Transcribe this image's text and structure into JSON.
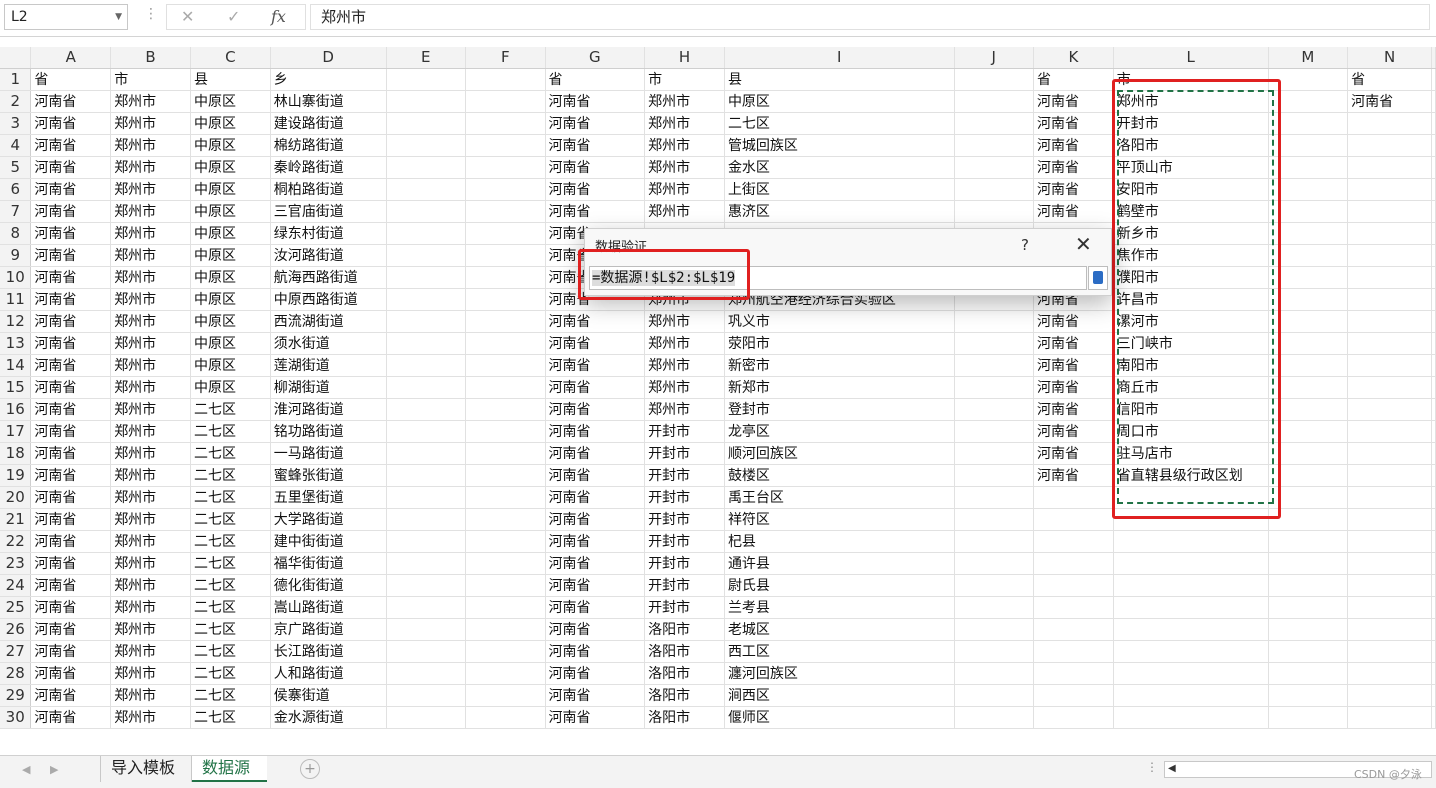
{
  "name_box": "L2",
  "formula_bar": {
    "cancel_icon": "✕",
    "enter_icon": "✓",
    "fx_label": "fx",
    "content": "郑州市"
  },
  "columns": [
    "A",
    "B",
    "C",
    "D",
    "E",
    "F",
    "G",
    "H",
    "I",
    "J",
    "K",
    "L",
    "M",
    "N"
  ],
  "row_numbers": [
    "1",
    "2",
    "3",
    "4",
    "5",
    "6",
    "7",
    "8",
    "9",
    "10",
    "11",
    "12",
    "13",
    "14",
    "15",
    "16",
    "17",
    "18",
    "19",
    "20",
    "21",
    "22",
    "23",
    "24",
    "25",
    "26",
    "27",
    "28",
    "29",
    "30"
  ],
  "rows": [
    [
      "省",
      "市",
      "县",
      "乡",
      "",
      "",
      "省",
      "市",
      "县",
      "",
      "省",
      "市",
      "",
      "省"
    ],
    [
      "河南省",
      "郑州市",
      "中原区",
      "林山寨街道",
      "",
      "",
      "河南省",
      "郑州市",
      "中原区",
      "",
      "河南省",
      "郑州市",
      "",
      "河南省"
    ],
    [
      "河南省",
      "郑州市",
      "中原区",
      "建设路街道",
      "",
      "",
      "河南省",
      "郑州市",
      "二七区",
      "",
      "河南省",
      "开封市",
      "",
      ""
    ],
    [
      "河南省",
      "郑州市",
      "中原区",
      "棉纺路街道",
      "",
      "",
      "河南省",
      "郑州市",
      "管城回族区",
      "",
      "河南省",
      "洛阳市",
      "",
      ""
    ],
    [
      "河南省",
      "郑州市",
      "中原区",
      "秦岭路街道",
      "",
      "",
      "河南省",
      "郑州市",
      "金水区",
      "",
      "河南省",
      "平顶山市",
      "",
      ""
    ],
    [
      "河南省",
      "郑州市",
      "中原区",
      "桐柏路街道",
      "",
      "",
      "河南省",
      "郑州市",
      "上街区",
      "",
      "河南省",
      "安阳市",
      "",
      ""
    ],
    [
      "河南省",
      "郑州市",
      "中原区",
      "三官庙街道",
      "",
      "",
      "河南省",
      "郑州市",
      "惠济区",
      "",
      "河南省",
      "鹤壁市",
      "",
      ""
    ],
    [
      "河南省",
      "郑州市",
      "中原区",
      "绿东村街道",
      "",
      "",
      "河南省",
      "",
      "",
      "",
      "",
      "新乡市",
      "",
      ""
    ],
    [
      "河南省",
      "郑州市",
      "中原区",
      "汝河路街道",
      "",
      "",
      "河南省",
      "",
      "",
      "",
      "",
      "焦作市",
      "",
      ""
    ],
    [
      "河南省",
      "郑州市",
      "中原区",
      "航海西路街道",
      "",
      "",
      "河南省",
      "",
      "",
      "",
      "",
      "濮阳市",
      "",
      ""
    ],
    [
      "河南省",
      "郑州市",
      "中原区",
      "中原西路街道",
      "",
      "",
      "河南省",
      "郑州市",
      "郑州航空港经济综合实验区",
      "",
      "河南省",
      "许昌市",
      "",
      ""
    ],
    [
      "河南省",
      "郑州市",
      "中原区",
      "西流湖街道",
      "",
      "",
      "河南省",
      "郑州市",
      "巩义市",
      "",
      "河南省",
      "漯河市",
      "",
      ""
    ],
    [
      "河南省",
      "郑州市",
      "中原区",
      "须水街道",
      "",
      "",
      "河南省",
      "郑州市",
      "荥阳市",
      "",
      "河南省",
      "三门峡市",
      "",
      ""
    ],
    [
      "河南省",
      "郑州市",
      "中原区",
      "莲湖街道",
      "",
      "",
      "河南省",
      "郑州市",
      "新密市",
      "",
      "河南省",
      "南阳市",
      "",
      ""
    ],
    [
      "河南省",
      "郑州市",
      "中原区",
      "柳湖街道",
      "",
      "",
      "河南省",
      "郑州市",
      "新郑市",
      "",
      "河南省",
      "商丘市",
      "",
      ""
    ],
    [
      "河南省",
      "郑州市",
      "二七区",
      "淮河路街道",
      "",
      "",
      "河南省",
      "郑州市",
      "登封市",
      "",
      "河南省",
      "信阳市",
      "",
      ""
    ],
    [
      "河南省",
      "郑州市",
      "二七区",
      "铭功路街道",
      "",
      "",
      "河南省",
      "开封市",
      "龙亭区",
      "",
      "河南省",
      "周口市",
      "",
      ""
    ],
    [
      "河南省",
      "郑州市",
      "二七区",
      "一马路街道",
      "",
      "",
      "河南省",
      "开封市",
      "顺河回族区",
      "",
      "河南省",
      "驻马店市",
      "",
      ""
    ],
    [
      "河南省",
      "郑州市",
      "二七区",
      "蜜蜂张街道",
      "",
      "",
      "河南省",
      "开封市",
      "鼓楼区",
      "",
      "河南省",
      "省直辖县级行政区划",
      "",
      ""
    ],
    [
      "河南省",
      "郑州市",
      "二七区",
      "五里堡街道",
      "",
      "",
      "河南省",
      "开封市",
      "禹王台区",
      "",
      "",
      "",
      "",
      ""
    ],
    [
      "河南省",
      "郑州市",
      "二七区",
      "大学路街道",
      "",
      "",
      "河南省",
      "开封市",
      "祥符区",
      "",
      "",
      "",
      "",
      ""
    ],
    [
      "河南省",
      "郑州市",
      "二七区",
      "建中街街道",
      "",
      "",
      "河南省",
      "开封市",
      "杞县",
      "",
      "",
      "",
      "",
      ""
    ],
    [
      "河南省",
      "郑州市",
      "二七区",
      "福华街街道",
      "",
      "",
      "河南省",
      "开封市",
      "通许县",
      "",
      "",
      "",
      "",
      ""
    ],
    [
      "河南省",
      "郑州市",
      "二七区",
      "德化街街道",
      "",
      "",
      "河南省",
      "开封市",
      "尉氏县",
      "",
      "",
      "",
      "",
      ""
    ],
    [
      "河南省",
      "郑州市",
      "二七区",
      "嵩山路街道",
      "",
      "",
      "河南省",
      "开封市",
      "兰考县",
      "",
      "",
      "",
      "",
      ""
    ],
    [
      "河南省",
      "郑州市",
      "二七区",
      "京广路街道",
      "",
      "",
      "河南省",
      "洛阳市",
      "老城区",
      "",
      "",
      "",
      "",
      ""
    ],
    [
      "河南省",
      "郑州市",
      "二七区",
      "长江路街道",
      "",
      "",
      "河南省",
      "洛阳市",
      "西工区",
      "",
      "",
      "",
      "",
      ""
    ],
    [
      "河南省",
      "郑州市",
      "二七区",
      "人和路街道",
      "",
      "",
      "河南省",
      "洛阳市",
      "瀍河回族区",
      "",
      "",
      "",
      "",
      ""
    ],
    [
      "河南省",
      "郑州市",
      "二七区",
      "侯寨街道",
      "",
      "",
      "河南省",
      "洛阳市",
      "涧西区",
      "",
      "",
      "",
      "",
      ""
    ],
    [
      "河南省",
      "郑州市",
      "二七区",
      "金水源街道",
      "",
      "",
      "河南省",
      "洛阳市",
      "偃师区",
      "",
      "",
      "",
      "",
      ""
    ]
  ],
  "dialog": {
    "title": "数据验证",
    "help_icon": "?",
    "close_icon": "✕",
    "formula": "=数据源!$L$2:$L$19"
  },
  "sheet_tabs": [
    "导入模板",
    "数据源"
  ],
  "add_sheet_icon": "+",
  "watermark": "CSDN @夕泳",
  "colors": {
    "accent": "#217346",
    "highlight_red": "#e02020"
  }
}
